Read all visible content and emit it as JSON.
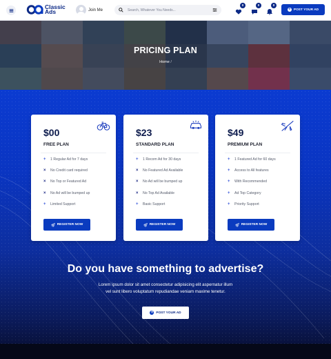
{
  "header": {
    "logo_line1": "Classic",
    "logo_line2": "Ads",
    "join_label": "Join Me",
    "search_placeholder": "Search, Whatever You Needs...",
    "badges": {
      "favorites": "0",
      "messages": "0",
      "notifications": "0"
    },
    "post_ad_label": "POST YOUR AD"
  },
  "hero": {
    "title": "PRICING PLAN",
    "breadcrumb_home": "Home",
    "breadcrumb_sep": "/"
  },
  "plans": [
    {
      "price": "$00",
      "name": "FREE PLAN",
      "icon": "bicycle-icon",
      "features": [
        {
          "included": true,
          "text": "1 Regular Ad for 7 days"
        },
        {
          "included": false,
          "text": "No Credit card required"
        },
        {
          "included": false,
          "text": "No Top or Featured Ad"
        },
        {
          "included": false,
          "text": "No Ad will be bumped up"
        },
        {
          "included": true,
          "text": "Limited Support"
        }
      ],
      "button_label": "REGISTER NOW"
    },
    {
      "price": "$23",
      "name": "STANDARD PLAN",
      "icon": "car-icon",
      "features": [
        {
          "included": true,
          "text": "1 Recom Ad for 30 days"
        },
        {
          "included": false,
          "text": "No Featured Ad Available"
        },
        {
          "included": false,
          "text": "No Ad will be bumped up"
        },
        {
          "included": false,
          "text": "No Top Ad Available"
        },
        {
          "included": true,
          "text": "Basic Support"
        }
      ],
      "button_label": "REGISTER NOW"
    },
    {
      "price": "$49",
      "name": "PREMIUM PLAN",
      "icon": "airplane-icon",
      "features": [
        {
          "included": true,
          "text": "1 Featured Ad for 60 days"
        },
        {
          "included": true,
          "text": "Access to All features"
        },
        {
          "included": true,
          "text": "With Recommended"
        },
        {
          "included": true,
          "text": "Ad Top Category"
        },
        {
          "included": true,
          "text": "Priority Support"
        }
      ],
      "button_label": "REGISTER NOW"
    }
  ],
  "cta": {
    "heading": "Do you have something to advertise?",
    "text_line1": "Lorem ipsum dolor sit amet consectetur adipisicing elit aspernatur illum",
    "text_line2": "vel sunt libero voluptatum repudiandae veniam maxime tenetur.",
    "button_label": "POST YOUR AD"
  },
  "colors": {
    "brand": "#0a3bbf",
    "brand_dark": "#0d2a86",
    "check": "#2d4ed8",
    "cross": "#1e2b85"
  }
}
